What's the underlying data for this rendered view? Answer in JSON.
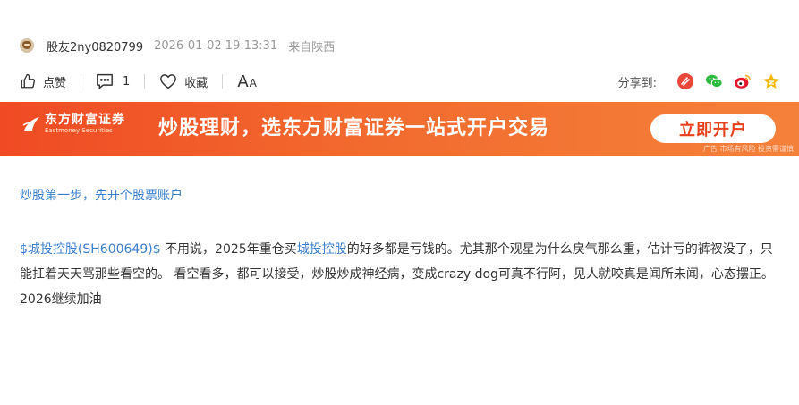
{
  "post": {
    "username": "股友2ny0820799",
    "timestamp": "2026-01-02 19:13:31",
    "location": "来自陕西"
  },
  "actions": {
    "like_label": "点赞",
    "comment_count": "1",
    "favorite_label": "收藏",
    "font_big": "A",
    "font_small": "A",
    "share_label": "分享到:"
  },
  "banner": {
    "logo_cn": "东方财富证券",
    "logo_en": "Eastmoney Securities",
    "slogan": "炒股理财，选东方财富证券一站式开户交易",
    "button_label": "立即开户",
    "note": "广告 市场有风险 投资需谨慎"
  },
  "promo_link": "炒股第一步，先开个股票账户",
  "content": {
    "stock_tag": "$城投控股(SH600649)$",
    "text_1": " 不用说，2025年重仓买",
    "stock_link": "城投控股",
    "text_2": "的好多都是亏钱的。尤其那个观星为什么戾气那么重，估计亏的裤衩没了，只能扛着天天骂那些看空的。 看空看多，都可以接受，炒股炒成神经病，变成crazy dog可真不行阿，见人就咬真是闻所未闻，心态摆正。2026继续加油"
  },
  "colors": {
    "link": "#3a7fcf",
    "banner_start": "#f04a24",
    "banner_end": "#f4813a",
    "button_text": "#e8401c"
  },
  "icons": [
    "avatar",
    "thumb-up-icon",
    "comment-icon",
    "heart-icon",
    "weibo-icon",
    "wechat-icon",
    "sina-weibo-icon",
    "qzone-icon"
  ]
}
